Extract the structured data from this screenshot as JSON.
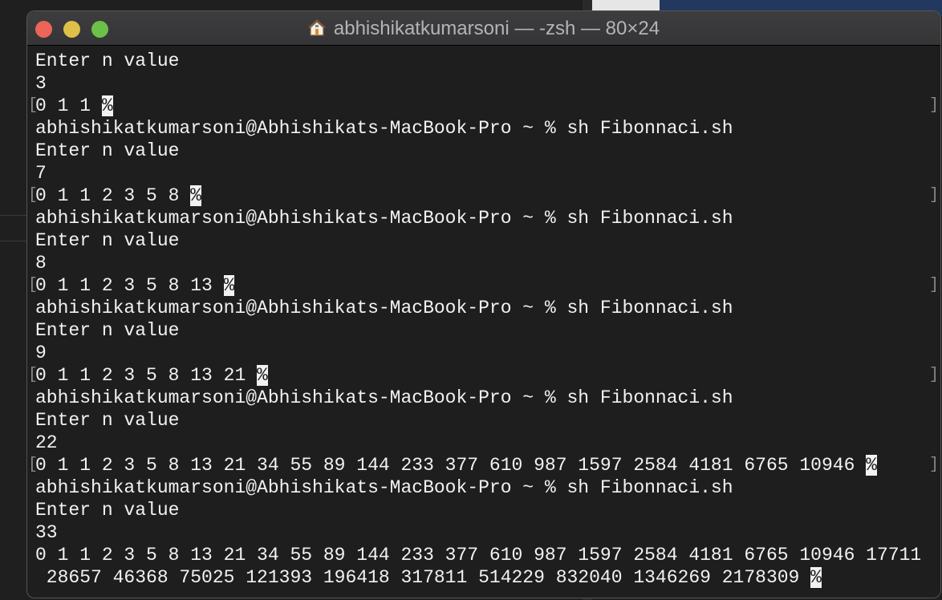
{
  "window": {
    "title": "abhishikatkumarsoni — -zsh — 80×24",
    "colors": {
      "close": "#ec6559",
      "minimize": "#e0bf48",
      "maximize": "#6cc04a",
      "background": "#1e1e1e",
      "text": "#f2f2f2"
    }
  },
  "terminal": {
    "lines": [
      {
        "text": "Enter n value"
      },
      {
        "text": "3"
      },
      {
        "text": "0 1 1 ",
        "mark": "%",
        "brackets": true
      },
      {
        "text": "abhishikatkumarsoni@Abhishikats-MacBook-Pro ~ % sh Fibonnaci.sh"
      },
      {
        "text": "Enter n value"
      },
      {
        "text": "7"
      },
      {
        "text": "0 1 1 2 3 5 8 ",
        "mark": "%",
        "brackets": true
      },
      {
        "text": "abhishikatkumarsoni@Abhishikats-MacBook-Pro ~ % sh Fibonnaci.sh"
      },
      {
        "text": "Enter n value"
      },
      {
        "text": "8"
      },
      {
        "text": "0 1 1 2 3 5 8 13 ",
        "mark": "%",
        "brackets": true
      },
      {
        "text": "abhishikatkumarsoni@Abhishikats-MacBook-Pro ~ % sh Fibonnaci.sh"
      },
      {
        "text": "Enter n value"
      },
      {
        "text": "9"
      },
      {
        "text": "0 1 1 2 3 5 8 13 21 ",
        "mark": "%",
        "brackets": true
      },
      {
        "text": "abhishikatkumarsoni@Abhishikats-MacBook-Pro ~ % sh Fibonnaci.sh"
      },
      {
        "text": "Enter n value"
      },
      {
        "text": "22"
      },
      {
        "text": "0 1 1 2 3 5 8 13 21 34 55 89 144 233 377 610 987 1597 2584 4181 6765 10946 ",
        "mark": "%",
        "brackets": true
      },
      {
        "text": "abhishikatkumarsoni@Abhishikats-MacBook-Pro ~ % sh Fibonnaci.sh"
      },
      {
        "text": "Enter n value"
      },
      {
        "text": "33"
      },
      {
        "text": "0 1 1 2 3 5 8 13 21 34 55 89 144 233 377 610 987 1597 2584 4181 6765 10946 17711"
      },
      {
        "text": " 28657 46368 75025 121393 196418 317811 514229 832040 1346269 2178309 ",
        "mark": "%"
      }
    ]
  }
}
